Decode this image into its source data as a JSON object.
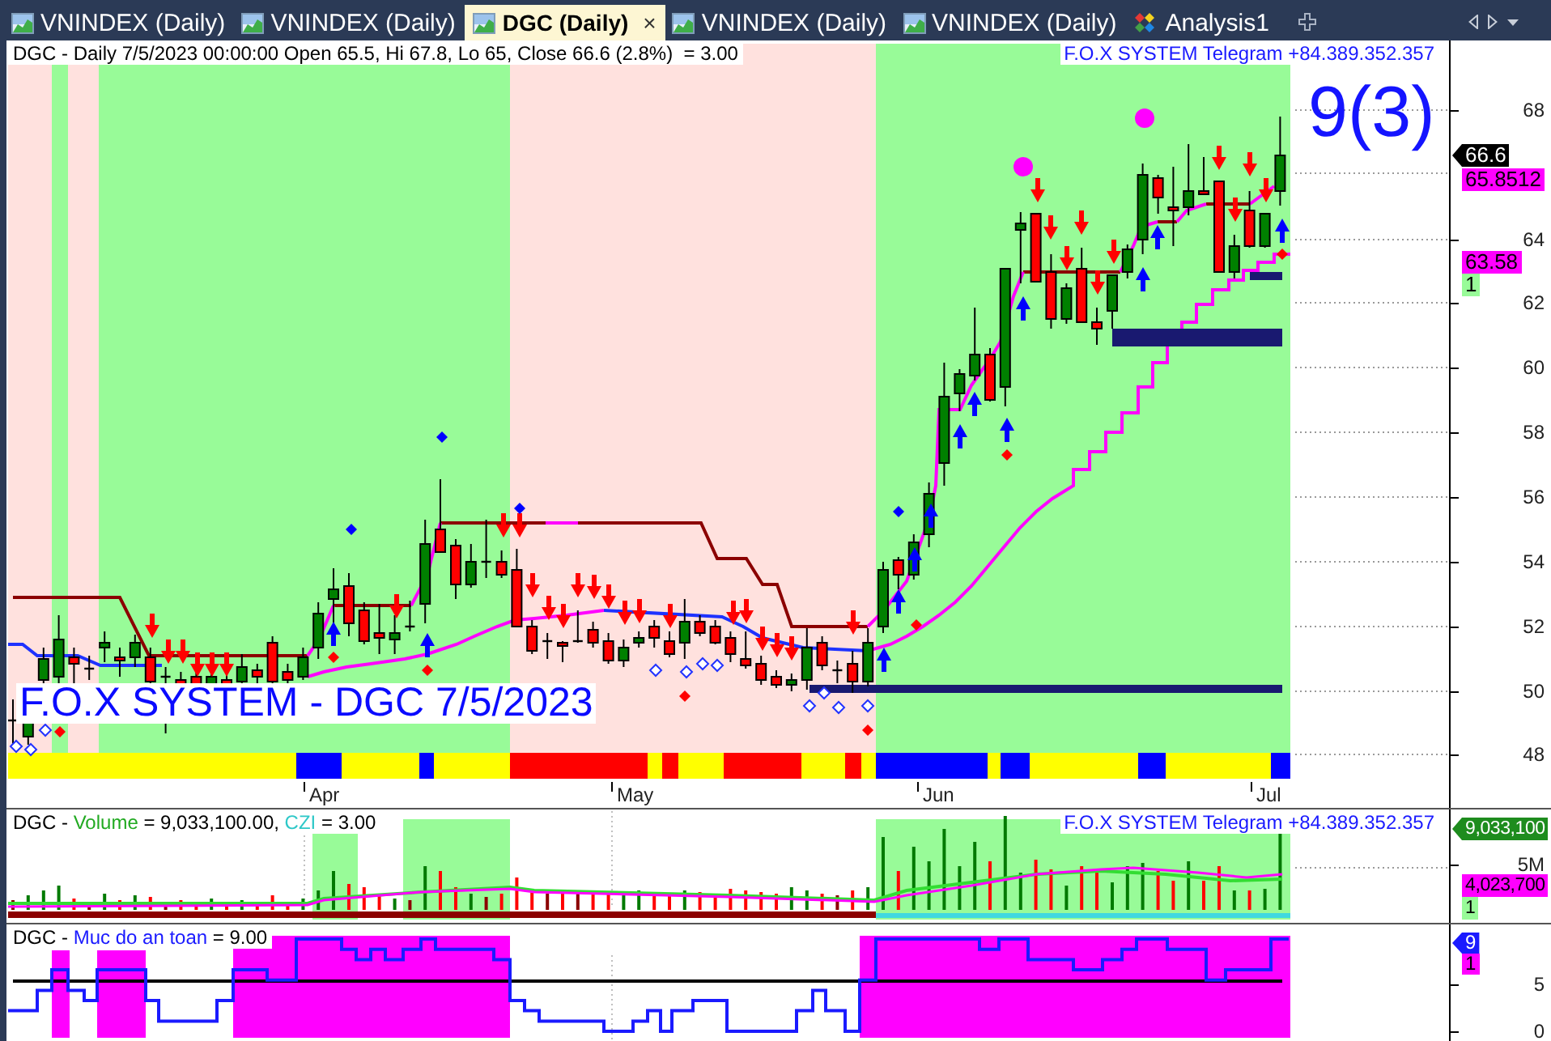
{
  "tabs": [
    {
      "label": "VNINDEX (Daily)",
      "kind": "chart",
      "selected": false
    },
    {
      "label": "VNINDEX (Daily)",
      "kind": "chart",
      "selected": false
    },
    {
      "label": "DGC (Daily)",
      "kind": "chart",
      "selected": true,
      "close": "×"
    },
    {
      "label": "VNINDEX (Daily)",
      "kind": "chart",
      "selected": false
    },
    {
      "label": "VNINDEX (Daily)",
      "kind": "chart",
      "selected": false
    },
    {
      "label": "Analysis1",
      "kind": "analysis",
      "selected": false
    }
  ],
  "price_pane": {
    "title": "DGC - Daily 7/5/2023 00:00:00 Open 65.5, Hi 67.8, Lo 65, Close 66.6 (2.8%)  = 3.00",
    "contact": "F.O.X SYSTEM Telegram +84.389.352.357",
    "signal": "9(3)",
    "caption": "F.O.X SYSTEM - DGC 7/5/2023",
    "x_labels": [
      "Apr",
      "May",
      "Jun",
      "Jul"
    ],
    "y_labels": [
      "68",
      "64",
      "62",
      "60",
      "58",
      "56",
      "54",
      "52",
      "50",
      "48"
    ],
    "tags": [
      {
        "text": "66.6",
        "kind": "pointer",
        "color": "#000000"
      },
      {
        "text": "65.8512",
        "kind": "box",
        "color": "#ff00ff"
      },
      {
        "text": "63.58",
        "kind": "box",
        "color": "#ff00ff"
      },
      {
        "text": "1",
        "kind": "box",
        "color": "#98fb98"
      }
    ]
  },
  "volume_pane": {
    "legend": [
      {
        "text": "DGC - ",
        "color": "#000000"
      },
      {
        "text": "Volume",
        "color": "#22aa22"
      },
      {
        "text": " = 9,033,100.00, ",
        "color": "#000000"
      },
      {
        "text": "CZI",
        "color": "#2ec8c8"
      },
      {
        "text": " = 3.00",
        "color": "#000000"
      }
    ],
    "contact": "F.O.X SYSTEM Telegram +84.389.352.357",
    "y_labels": [
      "5M"
    ],
    "tags": [
      {
        "text": "9,033,100",
        "kind": "pointer",
        "color": "#1e8c1e"
      },
      {
        "text": "4,023,700",
        "kind": "box",
        "color": "#ff00ff"
      },
      {
        "text": "1",
        "kind": "box",
        "color": "#98fb98"
      }
    ]
  },
  "safety_pane": {
    "legend": [
      {
        "text": "DGC - ",
        "color": "#000000"
      },
      {
        "text": "Muc do an toan",
        "color": "#1a1aff"
      },
      {
        "text": " = 9.00",
        "color": "#000000"
      }
    ],
    "y_labels": [
      "5",
      "0"
    ],
    "tags": [
      {
        "text": "9",
        "kind": "pointer",
        "color": "#1a1aff"
      },
      {
        "text": "1",
        "kind": "box",
        "color": "#ff00ff"
      }
    ]
  }
}
